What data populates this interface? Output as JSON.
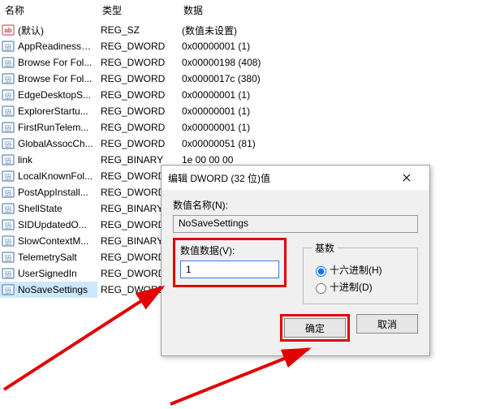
{
  "columns": {
    "name": "名称",
    "type": "类型",
    "data": "数据"
  },
  "rows": [
    {
      "icon": "str",
      "name": "(默认)",
      "type": "REG_SZ",
      "data": "(数值未设置)"
    },
    {
      "icon": "dw",
      "name": "AppReadinessL...",
      "type": "REG_DWORD",
      "data": "0x00000001 (1)"
    },
    {
      "icon": "dw",
      "name": "Browse For Fol...",
      "type": "REG_DWORD",
      "data": "0x00000198 (408)"
    },
    {
      "icon": "dw",
      "name": "Browse For Fol...",
      "type": "REG_DWORD",
      "data": "0x0000017c (380)"
    },
    {
      "icon": "dw",
      "name": "EdgeDesktopS...",
      "type": "REG_DWORD",
      "data": "0x00000001 (1)"
    },
    {
      "icon": "dw",
      "name": "ExplorerStartu...",
      "type": "REG_DWORD",
      "data": "0x00000001 (1)"
    },
    {
      "icon": "dw",
      "name": "FirstRunTelem...",
      "type": "REG_DWORD",
      "data": "0x00000001 (1)"
    },
    {
      "icon": "dw",
      "name": "GlobalAssocCh...",
      "type": "REG_DWORD",
      "data": "0x00000051 (81)"
    },
    {
      "icon": "dw",
      "name": "link",
      "type": "REG_BINARY",
      "data": "1e 00 00 00"
    },
    {
      "icon": "dw",
      "name": "LocalKnownFol...",
      "type": "REG_DWORD",
      "data": ""
    },
    {
      "icon": "dw",
      "name": "PostAppInstall...",
      "type": "REG_DWORD",
      "data": ""
    },
    {
      "icon": "dw",
      "name": "ShellState",
      "type": "REG_BINARY",
      "data": ""
    },
    {
      "icon": "dw",
      "name": "SIDUpdatedO...",
      "type": "REG_DWORD",
      "data": ""
    },
    {
      "icon": "dw",
      "name": "SlowContextM...",
      "type": "REG_BINARY",
      "data": ""
    },
    {
      "icon": "dw",
      "name": "TelemetrySalt",
      "type": "REG_DWORD",
      "data": ""
    },
    {
      "icon": "dw",
      "name": "UserSignedIn",
      "type": "REG_DWORD",
      "data": ""
    },
    {
      "icon": "dw",
      "name": "NoSaveSettings",
      "type": "REG_DWORD",
      "data": "",
      "selected": true
    }
  ],
  "dialog": {
    "title": "编辑 DWORD (32 位)值",
    "name_label": "数值名称(N):",
    "name_value": "NoSaveSettings",
    "data_label": "数值数据(V):",
    "data_value": "1",
    "base_label": "基数",
    "hex_label": "十六进制(H)",
    "dec_label": "十进制(D)",
    "ok": "确定",
    "cancel": "取消"
  },
  "colors": {
    "highlight": "#e20000",
    "selection": "#cce8ff"
  }
}
